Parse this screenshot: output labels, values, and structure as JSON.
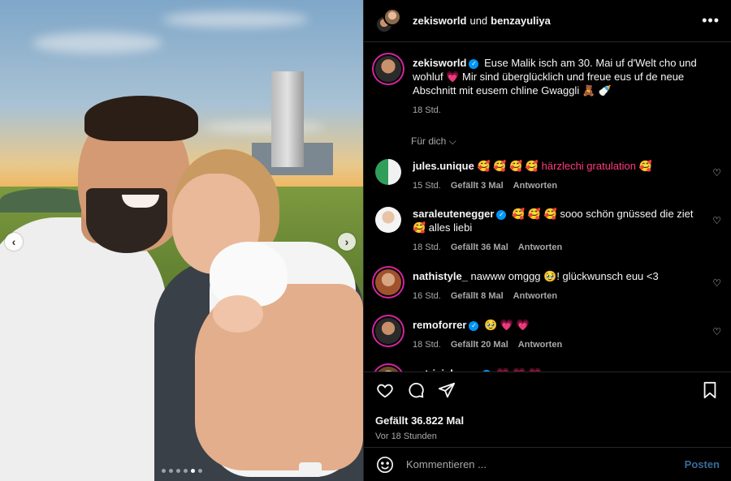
{
  "header": {
    "user1": "zekisworld",
    "connector": "und",
    "user2": "benzayuliya",
    "more_icon": "more-horizontal-icon"
  },
  "caption": {
    "username": "zekisworld",
    "text": "Euse Malik isch am 30. Mai uf d'Welt cho und wohluf 💗 Mir sind überglücklich und freue eus uf de neue Abschnitt mit eusem chline Gwaggli 🧸 🍼",
    "time": "18 Std."
  },
  "for_you": "Für dich ⌵",
  "comments": [
    {
      "username": "jules.unique",
      "verified": false,
      "text": "🥰 🥰 🥰 🥰 härzlechi gratulation 🥰",
      "time": "15 Std.",
      "likes": "Gefällt 3 Mal",
      "reply": "Antworten"
    },
    {
      "username": "saraleutenegger",
      "verified": true,
      "text": "🥰 🥰 🥰 sooo schön gnüssed die ziet 🥰 alles liebi",
      "time": "18 Std.",
      "likes": "Gefällt 36 Mal",
      "reply": "Antworten"
    },
    {
      "username": "nathistyle_",
      "verified": false,
      "text": "nawww omggg 🥹! glückwunsch euu <3",
      "time": "16 Std.",
      "likes": "Gefällt 8 Mal",
      "reply": "Antworten"
    },
    {
      "username": "remoforrer",
      "verified": true,
      "text": "🥹 💗 💗",
      "time": "18 Std.",
      "likes": "Gefällt 20 Mal",
      "reply": "Antworten"
    },
    {
      "username": "patriciaboser",
      "verified": true,
      "text": "💗 💗 💗",
      "time": "",
      "likes": "",
      "reply": ""
    }
  ],
  "actions": {
    "likes": "Gefällt 36.822 Mal",
    "time": "Vor 18 Stunden"
  },
  "compose": {
    "placeholder": "Kommentieren ...",
    "post_label": "Posten"
  },
  "carousel": {
    "prev_icon": "chevron-left-icon",
    "next_icon": "chevron-right-icon",
    "dots": 6,
    "active_dot": 4
  },
  "colors": {
    "accent": "#0095f6",
    "ring": "#d6249f",
    "muted": "#a8a8a8",
    "post": "#3a6b9c"
  }
}
